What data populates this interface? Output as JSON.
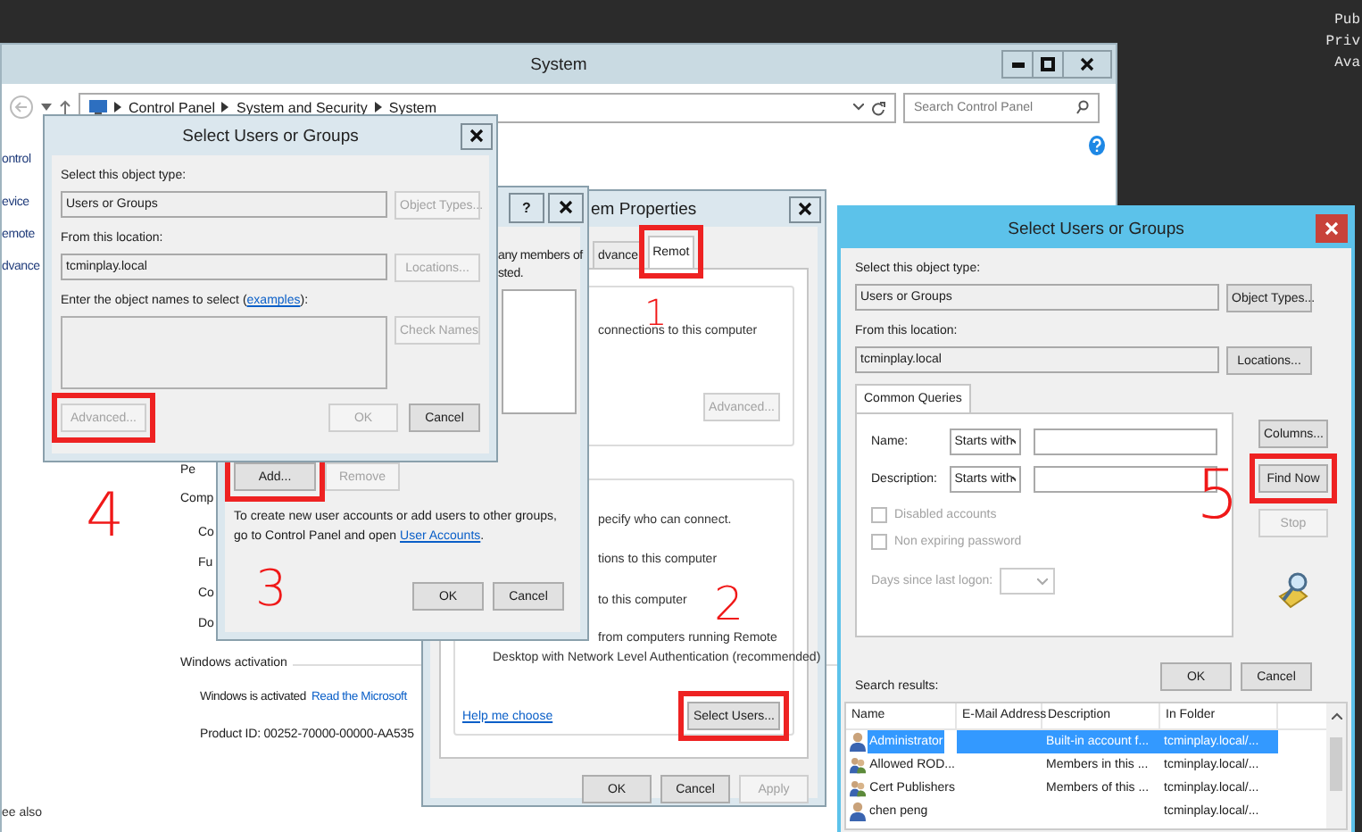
{
  "desktop_text": [
    "Pub",
    "Priv",
    "Ava"
  ],
  "system_window": {
    "title": "System",
    "breadcrumb": [
      "Control Panel",
      "System and Security",
      "System"
    ],
    "search": {
      "placeholder": "Search Control Panel"
    },
    "sidebar_items": [
      "ontrol",
      "evice",
      "emote",
      "dvance"
    ],
    "section_fragment": "Pe",
    "computer_heading": "Comp",
    "computer_rows": [
      "Co",
      "Fu",
      "Co",
      "Do"
    ],
    "activation": {
      "heading": "Windows activation",
      "status": "Windows is activated",
      "link": "Read the Microsoft",
      "product_id": "Product ID: 00252-70000-00000-AA535"
    },
    "see_also": "ee also"
  },
  "system_properties": {
    "title": "em Properties",
    "tabs": [
      {
        "label": "dvance",
        "selected": false,
        "highlighted": false
      },
      {
        "label": "Remot",
        "selected": true,
        "highlighted": true
      }
    ],
    "group_1": {
      "text": "connections to this computer",
      "button": {
        "label": "Advanced...",
        "disabled": true,
        "highlighted": false
      }
    },
    "group_2": {
      "lines": [
        "pecify who can connect.",
        "tions to this computer",
        "to this computer",
        "from computers running Remote",
        "Desktop with Network Level Authentication (recommended)"
      ],
      "link": "Help me choose",
      "button": {
        "label": "Select Users...",
        "disabled": false,
        "highlighted": true
      }
    },
    "buttons": [
      {
        "label": "OK",
        "disabled": false,
        "highlighted": false
      },
      {
        "label": "Cancel",
        "disabled": false,
        "highlighted": false
      },
      {
        "label": "Apply",
        "disabled": true,
        "highlighted": false
      }
    ]
  },
  "users_dialog": {
    "help_button": "?",
    "text_lines": [
      "any members of",
      "sted."
    ],
    "buttons": [
      {
        "label": "Add...",
        "disabled": false,
        "highlighted": true
      },
      {
        "label": "Remove",
        "disabled": true,
        "highlighted": false
      }
    ],
    "note_before": "To create new user accounts or add users to other groups, go to Control Panel and open ",
    "note_link": "User Accounts",
    "note_after": ".",
    "footer_buttons": [
      {
        "label": "OK",
        "disabled": false,
        "highlighted": false
      },
      {
        "label": "Cancel",
        "disabled": false,
        "highlighted": false
      }
    ]
  },
  "select_dialog_left": {
    "title": "Select Users or Groups",
    "object_type": {
      "label": "Select this object type:",
      "value": "Users or Groups",
      "disabled": true,
      "button": {
        "label": "Object Types...",
        "disabled": true,
        "highlighted": false
      }
    },
    "location": {
      "label": "From this location:",
      "value": "tcminplay.local",
      "disabled": true,
      "button": {
        "label": "Locations...",
        "disabled": true,
        "highlighted": false
      }
    },
    "names": {
      "label_before": "Enter the object names to select (",
      "link": "examples",
      "label_after": "):",
      "button": {
        "label": "Check Names",
        "disabled": true,
        "highlighted": false
      }
    },
    "buttons": [
      {
        "label": "Advanced...",
        "disabled": true,
        "highlighted": true
      },
      {
        "label": "OK",
        "disabled": true,
        "highlighted": false
      },
      {
        "label": "Cancel",
        "disabled": false,
        "highlighted": false
      }
    ]
  },
  "select_dialog_right": {
    "title": "Select Users or Groups",
    "object_type": {
      "label": "Select this object type:",
      "value": "Users or Groups",
      "disabled": true,
      "button": {
        "label": "Object Types...",
        "disabled": false,
        "highlighted": false
      }
    },
    "location": {
      "label": "From this location:",
      "value": "tcminplay.local",
      "disabled": true,
      "button": {
        "label": "Locations...",
        "disabled": false,
        "highlighted": false
      }
    },
    "query_tab": {
      "label": "Common Queries",
      "selected": true
    },
    "queries": [
      {
        "kind": "text",
        "label": "Name:",
        "operator": "Starts with",
        "disabled": false
      },
      {
        "kind": "text",
        "label": "Description:",
        "operator": "Starts with",
        "disabled": false
      },
      {
        "kind": "checkbox",
        "label": "Disabled accounts",
        "checked": false,
        "disabled": true
      },
      {
        "kind": "checkbox",
        "label": "Non expiring password",
        "checked": false,
        "disabled": true
      },
      {
        "kind": "days",
        "label": "Days since last logon:",
        "disabled": true
      }
    ],
    "side_buttons": [
      {
        "label": "Columns...",
        "disabled": false,
        "highlighted": false
      },
      {
        "label": "Find Now",
        "disabled": false,
        "highlighted": true
      },
      {
        "label": "Stop",
        "disabled": true,
        "highlighted": false
      }
    ],
    "buttons": [
      {
        "label": "OK",
        "disabled": false,
        "highlighted": false
      },
      {
        "label": "Cancel",
        "disabled": false,
        "highlighted": false
      }
    ],
    "results_label": "Search results:",
    "columns": [
      "Name",
      "E-Mail Address",
      "Description",
      "In Folder"
    ],
    "rows": [
      {
        "kind": "user",
        "name": "Administrator",
        "description": "Built-in account f...",
        "folder": "tcminplay.local/...",
        "selected": true
      },
      {
        "kind": "group",
        "name": "Allowed ROD...",
        "description": "Members in this ...",
        "folder": "tcminplay.local/...",
        "selected": false
      },
      {
        "kind": "group",
        "name": "Cert Publishers",
        "description": "Members of this ...",
        "folder": "tcminplay.local/...",
        "selected": false
      },
      {
        "kind": "user",
        "name": "chen peng",
        "folder": "tcminplay.local/...",
        "selected": false
      }
    ]
  },
  "annotations": [
    {
      "label": "1"
    },
    {
      "label": "2"
    },
    {
      "label": "3"
    },
    {
      "label": "4"
    },
    {
      "label": "5"
    }
  ]
}
